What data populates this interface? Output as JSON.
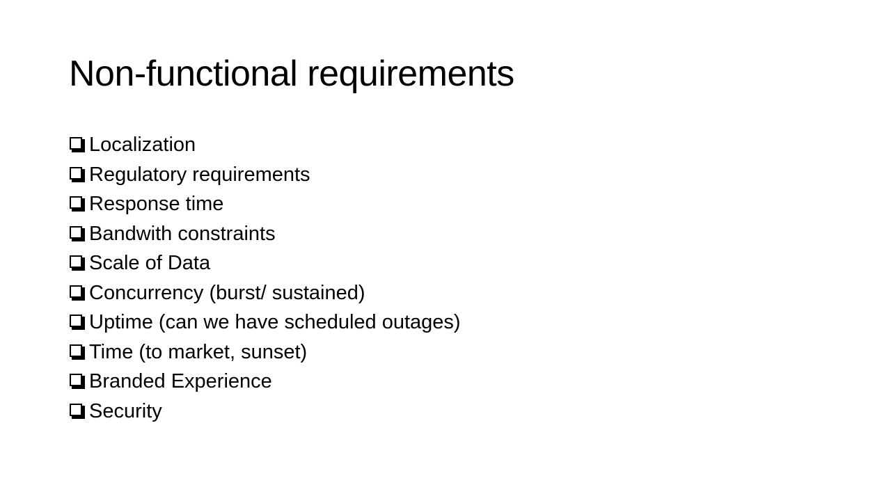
{
  "slide": {
    "title": "Non-functional requirements",
    "bullets": [
      {
        "icon": "checkbox-icon",
        "text": "Localization"
      },
      {
        "icon": "checkbox-icon",
        "text": "Regulatory requirements"
      },
      {
        "icon": "checkbox-icon",
        "text": "Response time"
      },
      {
        "icon": "checkbox-icon",
        "text": "Bandwith constraints"
      },
      {
        "icon": "checkbox-icon",
        "text": "Scale of Data"
      },
      {
        "icon": "checkbox-icon",
        "text": "Concurrency (burst/ sustained)"
      },
      {
        "icon": "checkbox-icon",
        "text": "Uptime (can we have scheduled outages)"
      },
      {
        "icon": "checkbox-icon",
        "text": "Time (to market, sunset)"
      },
      {
        "icon": "checkbox-icon",
        "text": "Branded Experience"
      },
      {
        "icon": "checkbox-icon",
        "text": "Security"
      }
    ]
  },
  "colors": {
    "background": "#ffffff",
    "text": "#000000"
  }
}
